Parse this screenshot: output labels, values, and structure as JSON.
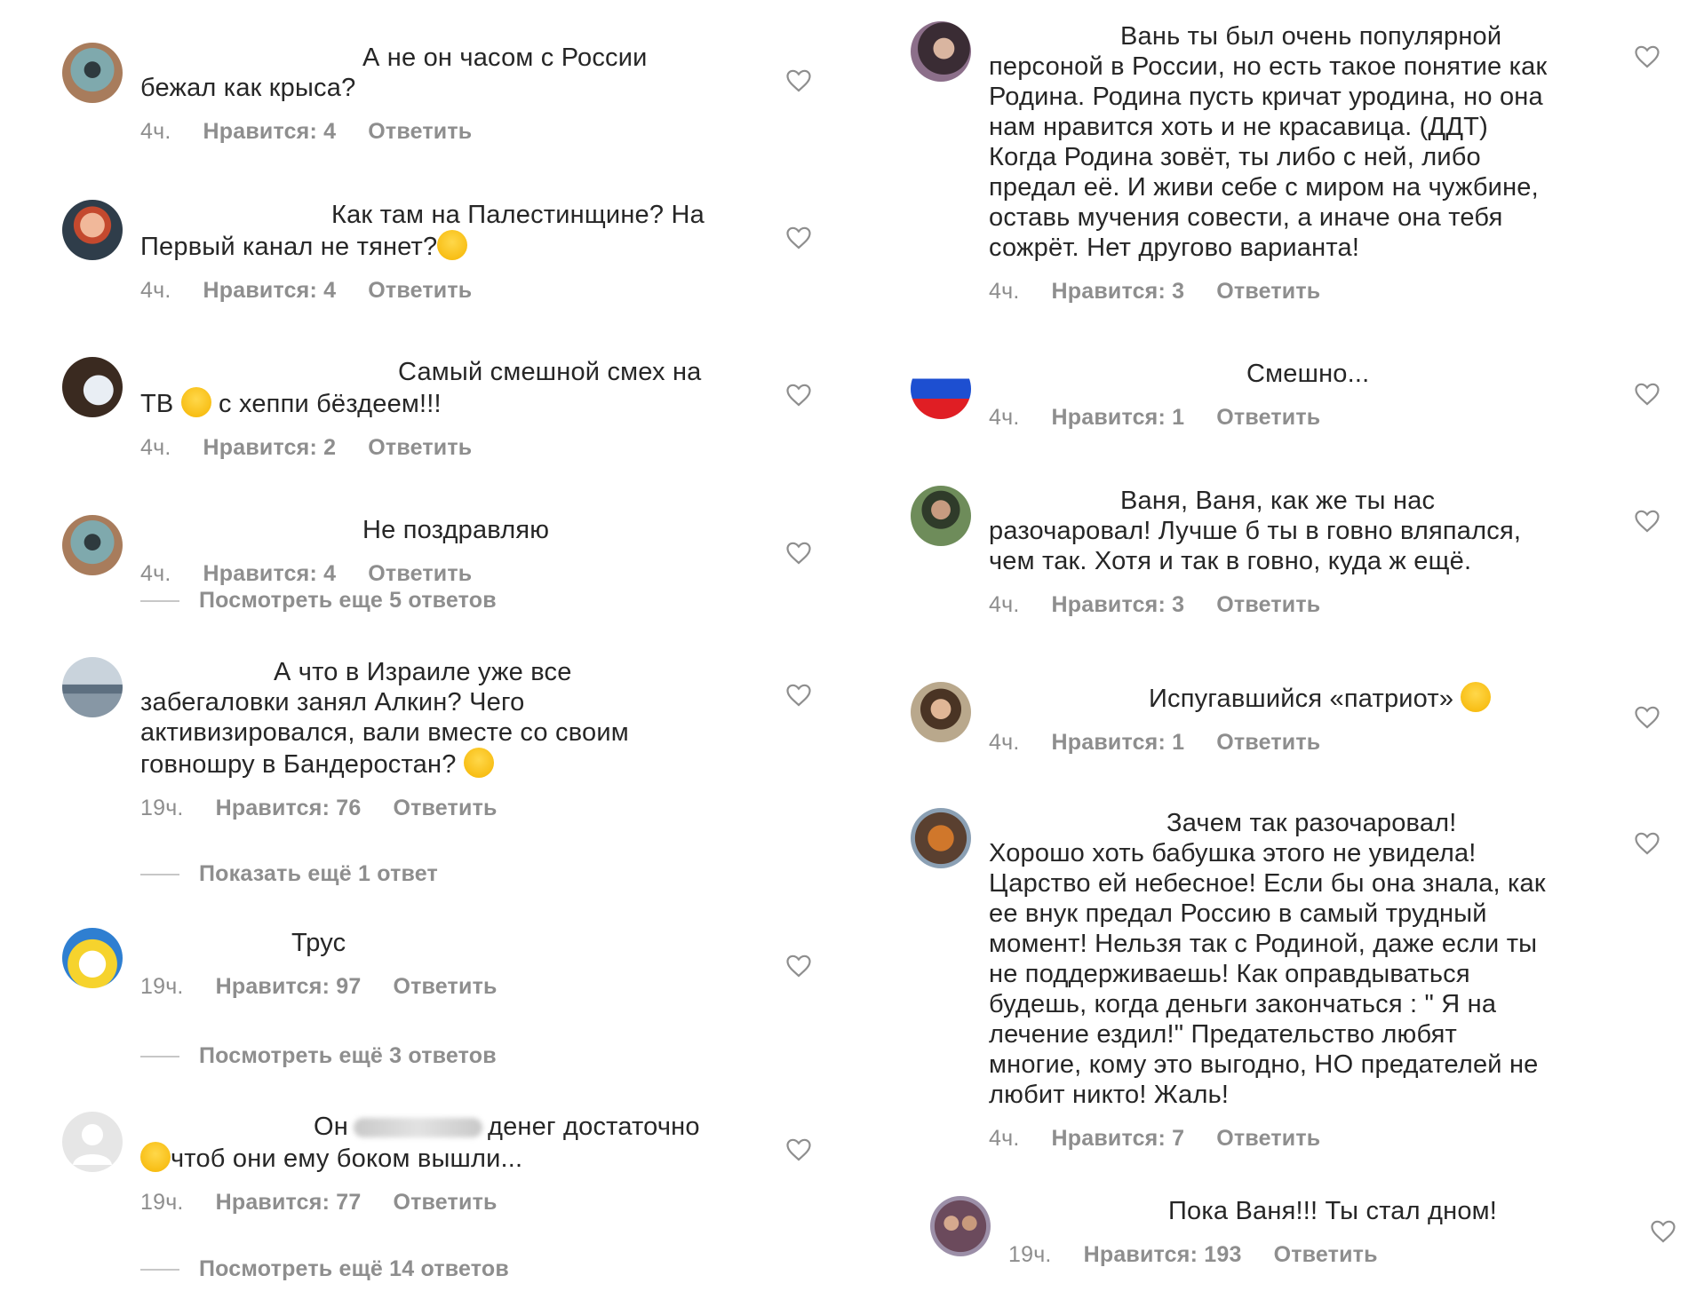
{
  "left_comments": [
    {
      "text_lines": [
        "А не он часом с России",
        "бежал как крыса?"
      ],
      "time": "4ч.",
      "likes": "Нравится: 4",
      "reply": "Ответить"
    },
    {
      "text_lines": [
        "Как там на Палестинщине? На",
        "Первый канал не тянет?"
      ],
      "time": "4ч.",
      "likes": "Нравится: 4",
      "reply": "Ответить"
    },
    {
      "text_lines": [
        "Самый смешной смех на",
        "ТВ",
        "с хеппи бёздеем!!!"
      ],
      "time": "4ч.",
      "likes": "Нравится: 2",
      "reply": "Ответить"
    },
    {
      "text_lines": [
        "Не поздравляю"
      ],
      "time": "4ч.",
      "likes": "Нравится: 4",
      "reply": "Ответить",
      "view_replies": "Посмотреть еще 5 ответов"
    },
    {
      "text_lines": [
        "А что в Израиле уже все",
        "забегаловки занял Алкин? Чего",
        "активизировался, вали вместе со своим",
        "говношру в Бандеростан?"
      ],
      "time": "19ч.",
      "likes": "Нравится: 76",
      "reply": "Ответить",
      "view_replies": "Показать ещё 1 ответ"
    },
    {
      "text_lines": [
        "Трус"
      ],
      "time": "19ч.",
      "likes": "Нравится: 97",
      "reply": "Ответить",
      "view_replies": "Посмотреть ещё 3 ответов"
    },
    {
      "text_lines": [
        "Он",
        "денег достаточно",
        "чтоб они ему боком вышли..."
      ],
      "time": "19ч.",
      "likes": "Нравится: 77",
      "reply": "Ответить",
      "view_replies": "Посмотреть ещё 14 ответов"
    }
  ],
  "right_comments": [
    {
      "text_lines": [
        "Вань ты был очень популярной",
        "персоной в России, но есть такое понятие как",
        "Родина. Родина пусть кричат уродина, но она",
        "нам нравится хоть и не красавица. (ДДТ)",
        "Когда Родина зовёт, ты либо с ней, либо",
        "предал её. И живи себе с миром на чужбине,",
        "оставь мучения совести, а иначе она тебя",
        "сожрёт. Нет другово варианта!"
      ],
      "time": "4ч.",
      "likes": "Нравится: 3",
      "reply": "Ответить"
    },
    {
      "text_lines": [
        "Смешно..."
      ],
      "time": "4ч.",
      "likes": "Нравится: 1",
      "reply": "Ответить"
    },
    {
      "text_lines": [
        "Ваня, Ваня, как же ты нас",
        "разочаровал! Лучше б ты в говно вляпался,",
        "чем так. Хотя и так в говно, куда ж ещё."
      ],
      "time": "4ч.",
      "likes": "Нравится: 3",
      "reply": "Ответить"
    },
    {
      "text_lines": [
        "Испугавшийся «патриот»"
      ],
      "time": "4ч.",
      "likes": "Нравится: 1",
      "reply": "Ответить"
    },
    {
      "text_lines": [
        "Зачем так разочаровал!",
        "Хорошо хоть бабушка этого не увидела!",
        "Царство ей небесное! Если бы она знала, как",
        "ее внук предал Россию в самый трудный",
        "момент! Нельзя так с Родиной, даже если ты",
        "не поддерживаешь!  Как оправдываться",
        "будешь, когда деньги закончаться : \" Я на",
        "лечение ездил!\" Предательство любят",
        "многие, кому это выгодно, НО предателей не",
        "любит никто! Жаль!"
      ],
      "time": "4ч.",
      "likes": "Нравится: 7",
      "reply": "Ответить"
    },
    {
      "text_lines": [
        "Пока  Ваня!!! Ты стал дном!"
      ],
      "time": "19ч.",
      "likes": "Нравится: 193",
      "reply": "Ответить"
    }
  ],
  "icons": {
    "like": "heart-outline-icon"
  },
  "colors": {
    "text": "#262626",
    "meta": "#8e8e8e",
    "divider": "#c7c7c7"
  }
}
